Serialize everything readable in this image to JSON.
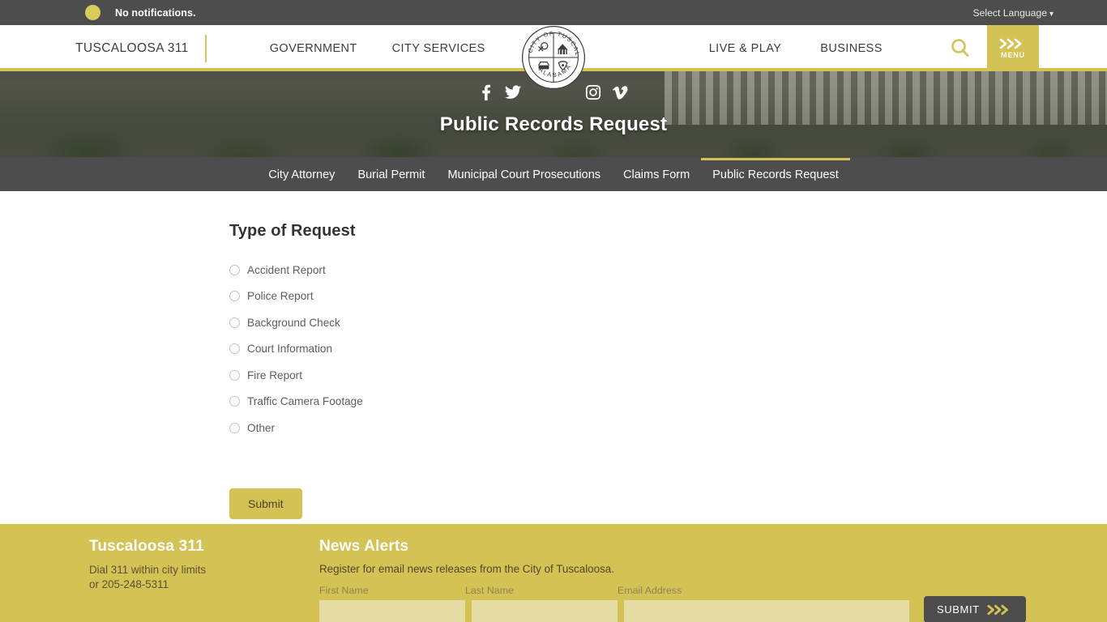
{
  "notification_bar": {
    "status_text": "No notifications.",
    "language_selector": "Select Language",
    "caret": "⌄",
    "dot_color": "#d9cb5c",
    "bar_color": "#4d4d4d"
  },
  "header": {
    "brand": "TUSCALOOSA 311",
    "nav": [
      {
        "label": "GOVERNMENT"
      },
      {
        "label": "CITY SERVICES"
      },
      {
        "label": "LIVE & PLAY"
      },
      {
        "label": "BUSINESS"
      }
    ],
    "search_icon": "search-icon",
    "menu_label": "MENU",
    "accent_color": "#d4c354",
    "seal_text_top": "CITY OF TUSCALOOSA",
    "seal_text_bottom": "ALABAMA"
  },
  "hero": {
    "title": "Public Records Request",
    "social": [
      {
        "name": "facebook-icon",
        "glyph": "f"
      },
      {
        "name": "twitter-icon",
        "glyph": "t"
      },
      {
        "name": "instagram-icon",
        "glyph": "i"
      },
      {
        "name": "vimeo-icon",
        "glyph": "v"
      }
    ]
  },
  "subnav": {
    "items": [
      {
        "label": "City Attorney",
        "active": false
      },
      {
        "label": "Burial Permit",
        "active": false
      },
      {
        "label": "Municipal Court Prosecutions",
        "active": false
      },
      {
        "label": "Claims Form",
        "active": false
      },
      {
        "label": "Public Records Request",
        "active": true
      }
    ],
    "active_indicator_color": "#d4c354",
    "background": "#4d4d4d"
  },
  "form": {
    "heading": "Type of Request",
    "options": [
      {
        "label": "Accident Report",
        "selected": false
      },
      {
        "label": "Police Report",
        "selected": false
      },
      {
        "label": "Background Check",
        "selected": false
      },
      {
        "label": "Court Information",
        "selected": false
      },
      {
        "label": "Fire Report",
        "selected": false
      },
      {
        "label": "Traffic Camera Footage",
        "selected": false
      },
      {
        "label": "Other",
        "selected": false
      }
    ],
    "submit_label": "Submit"
  },
  "footer": {
    "background": "#d4c354",
    "tuscaloosa311": {
      "title": "Tuscaloosa 311",
      "line1": "Dial 311 within city limits",
      "line2": "or 205-248-5311"
    },
    "news_alerts": {
      "title": "News Alerts",
      "description": "Register for email news releases from the City of Tuscaloosa.",
      "fields": [
        {
          "label": "First Name",
          "value": "",
          "placeholder": ""
        },
        {
          "label": "Last Name",
          "value": "",
          "placeholder": ""
        },
        {
          "label": "Email Address",
          "value": "",
          "placeholder": ""
        }
      ],
      "submit_label": "SUBMIT"
    }
  }
}
